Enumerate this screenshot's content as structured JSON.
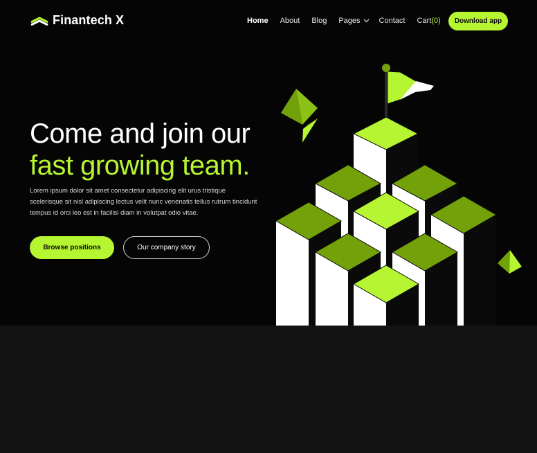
{
  "brand": {
    "name": "Finantech X",
    "logo_icon": "double-chevron-logo-icon"
  },
  "nav": {
    "items": [
      {
        "label": "Home",
        "active": true
      },
      {
        "label": "About"
      },
      {
        "label": "Blog"
      },
      {
        "label": "Pages",
        "has_dropdown": true,
        "icon": "chevron-down-icon"
      },
      {
        "label": "Contact"
      }
    ],
    "cart": {
      "label": "Cart",
      "count": "(0)"
    },
    "download_label": "Download app"
  },
  "hero": {
    "title_line1": "Come and join our",
    "title_line2": "fast growing team.",
    "description": "Lorem ipsum dolor sit amet consectetur adipiscing elit urus tristique scelerisque sit nisl adipiscing lectus velit nunc venenatis tellus rutrum tincidunt tempus id orci leo est in facilisi diam in volutpat odio vitae.",
    "primary_cta": "Browse positions",
    "secondary_cta": "Our company story"
  },
  "illustration": {
    "name": "isometric-pillars-with-flag-illustration"
  },
  "colors": {
    "accent": "#b6f531",
    "accent_dark": "#73a10a",
    "hero_background": "#050505",
    "page_background": "#131313"
  }
}
